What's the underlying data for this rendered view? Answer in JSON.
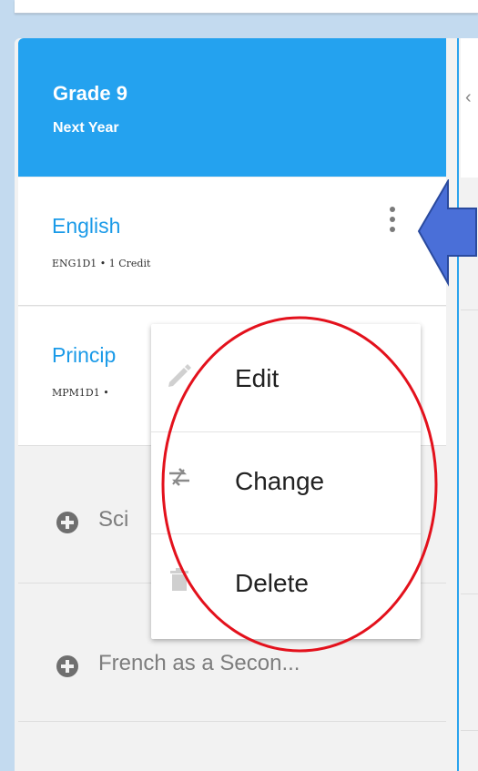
{
  "grade": {
    "title": "Grade 9",
    "subtitle": "Next Year"
  },
  "courses": [
    {
      "name": "English",
      "meta": "ENG1D1 • 1 Credit"
    },
    {
      "name": "Princip",
      "meta": "MPM1D1 •"
    }
  ],
  "add_slots": [
    {
      "label": "Sci"
    },
    {
      "label": "French as a Secon..."
    }
  ],
  "context_menu": {
    "items": [
      {
        "label": "Edit",
        "icon": "pencil-icon"
      },
      {
        "label": "Change",
        "icon": "swap-icon"
      },
      {
        "label": "Delete",
        "icon": "trash-icon"
      }
    ]
  },
  "annotations": {
    "arrow_color": "#4a6fd8",
    "ellipse_color": "#e3111c"
  },
  "colors": {
    "header_blue": "#24a2ef",
    "course_link": "#1a9ae8"
  }
}
